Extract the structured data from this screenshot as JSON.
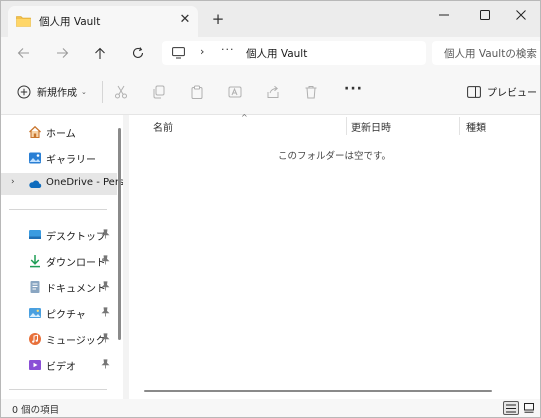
{
  "tab": {
    "title": "個人用 Vault",
    "close_glyph": "✕",
    "new_tab_glyph": "+",
    "folder_icon": "folder-icon"
  },
  "window_controls": {
    "minimize_icon": "minimize-icon",
    "maximize_icon": "maximize-icon",
    "close_icon": "close-icon"
  },
  "address": {
    "chevron": "›",
    "overflow": "···",
    "path": "個人用 Vault",
    "search_placeholder": "個人用 Vaultの検索"
  },
  "toolbar": {
    "new_label": "新規作成",
    "new_caret": "⌄",
    "more_glyph": "···",
    "preview_label": "プレビュー"
  },
  "sidebar": {
    "items": [
      {
        "label": "ホーム",
        "icon": "home-icon"
      },
      {
        "label": "ギャラリー",
        "icon": "gallery-icon"
      },
      {
        "label": "OneDrive - Personal",
        "icon": "onedrive-icon",
        "expand_glyph": "›"
      },
      {
        "label": "デスクトップ",
        "icon": "desktop-icon",
        "pinned": true
      },
      {
        "label": "ダウンロード",
        "icon": "download-icon",
        "pinned": true
      },
      {
        "label": "ドキュメント",
        "icon": "documents-icon",
        "pinned": true
      },
      {
        "label": "ピクチャ",
        "icon": "pictures-icon",
        "pinned": true
      },
      {
        "label": "ミュージック",
        "icon": "music-icon",
        "pinned": true
      },
      {
        "label": "ビデオ",
        "icon": "videos-icon",
        "pinned": true
      }
    ]
  },
  "content": {
    "sort_glyph": "^",
    "columns": [
      "名前",
      "更新日時",
      "種類"
    ],
    "empty_message": "このフォルダーは空です。"
  },
  "status": {
    "item_count": "0 個の項目"
  },
  "colors": {
    "accent": "#0067c0",
    "folder": "#f3c04c",
    "onedrive": "#0f6cbd",
    "titlebar": "#ececec",
    "toolbar": "#f7f7f7"
  }
}
